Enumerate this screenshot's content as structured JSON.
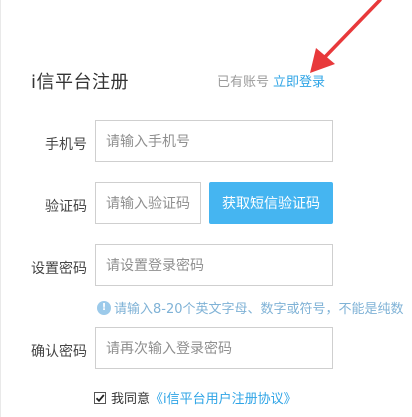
{
  "header": {
    "title": "i信平台注册",
    "has_account_text": "已有账号",
    "login_link": "立即登录"
  },
  "form": {
    "phone": {
      "label": "手机号",
      "placeholder": "请输入手机号"
    },
    "code": {
      "label": "验证码",
      "placeholder": "请输入验证码",
      "button": "获取短信验证码"
    },
    "password": {
      "label": "设置密码",
      "placeholder": "请设置登录密码",
      "hint": "请输入8-20个英文字母、数字或符号，不能是纯数"
    },
    "confirm": {
      "label": "确认密码",
      "placeholder": "请再次输入登录密码"
    },
    "agreement": {
      "checked": true,
      "text": "我同意",
      "link": "《i信平台用户注册协议》"
    }
  },
  "colors": {
    "accent": "#45b5f1",
    "link": "#2ea4e6",
    "arrow": "#e8393b"
  },
  "icons": {
    "info": "info-circle-icon",
    "checkmark": "checkmark-icon"
  }
}
